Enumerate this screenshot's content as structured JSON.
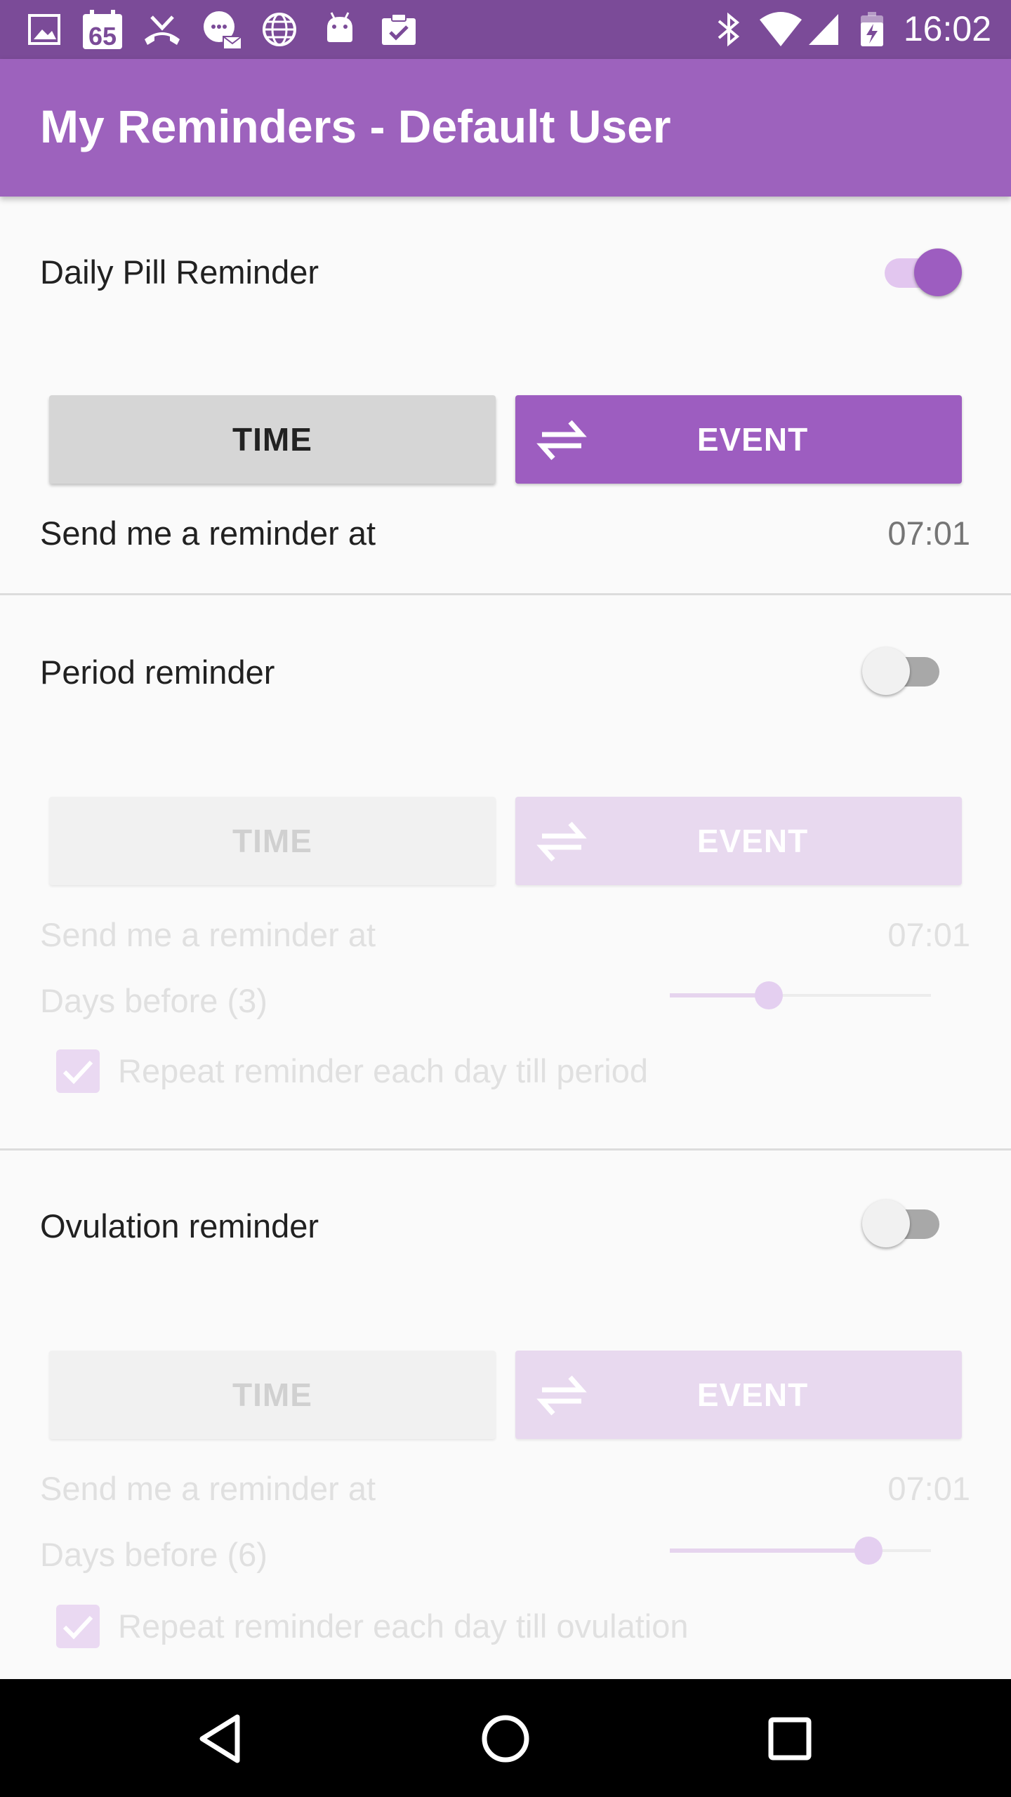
{
  "status_bar": {
    "time": "16:02",
    "calendar_day": "65",
    "left_icons": [
      "image-icon",
      "calendar-icon",
      "missed-call-icon",
      "chat-icon",
      "globe-icon",
      "android-icon",
      "clipboard-icon"
    ],
    "right_icons": [
      "bluetooth-icon",
      "wifi-icon",
      "signal-icon",
      "battery-charging-icon"
    ]
  },
  "app_bar": {
    "title": "My Reminders - Default User",
    "color": "#9d62bd"
  },
  "sections": {
    "pill": {
      "title": "Daily Pill Reminder",
      "enabled": true,
      "time_label": "TIME",
      "event_label": "EVENT",
      "reminder_label": "Send me a reminder at",
      "reminder_time": "07:01"
    },
    "period": {
      "title": "Period reminder",
      "enabled": false,
      "time_label": "TIME",
      "event_label": "EVENT",
      "reminder_label": "Send me a reminder at",
      "reminder_time": "07:01",
      "days_label": "Days before (3)",
      "days_before": 3,
      "slider_fraction": 0.38,
      "repeat_label": "Repeat reminder each day till period",
      "repeat_checked": true
    },
    "ovulation": {
      "title": "Ovulation reminder",
      "enabled": false,
      "time_label": "TIME",
      "event_label": "EVENT",
      "reminder_label": "Send me a reminder at",
      "reminder_time": "07:01",
      "days_label": "Days before (6)",
      "days_before": 6,
      "slider_fraction": 0.76,
      "repeat_label": "Repeat reminder each day till ovulation",
      "repeat_checked": true
    }
  },
  "nav_bar": {
    "buttons": [
      "back-icon",
      "home-icon",
      "recents-icon"
    ]
  },
  "colors": {
    "accent": "#9d5dc0",
    "status_bar": "#7b4b98"
  }
}
